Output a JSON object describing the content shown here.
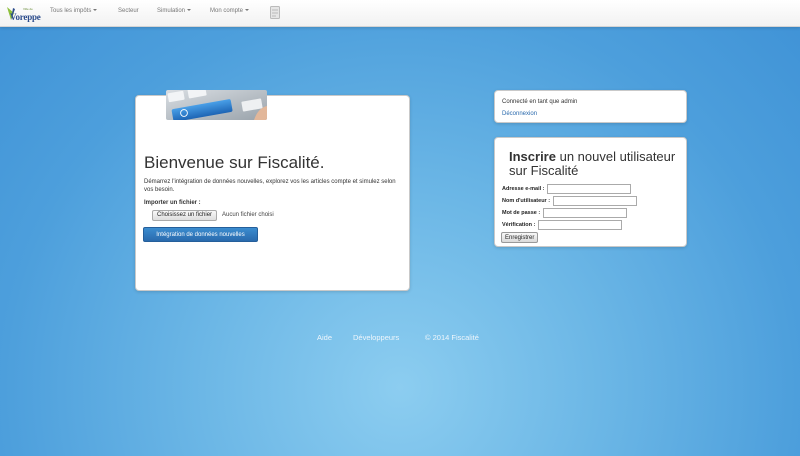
{
  "brand": {
    "name": "Voreppe",
    "tagline": "Ville de"
  },
  "nav": [
    {
      "label": "Tous les impôts",
      "dropdown": true
    },
    {
      "label": "Secteur",
      "dropdown": false
    },
    {
      "label": "Simulation",
      "dropdown": true
    },
    {
      "label": "Mon compte",
      "dropdown": true
    }
  ],
  "hero": {
    "image_key_label": "Fiscalité",
    "title": "Bienvenue sur Fiscalité.",
    "intro": "Démarrez l'intégration de données nouvelles, explorez vos les articles compte et simulez selon vos besoin.",
    "import_label": "Importer un fichier :",
    "file_button": "Choisissez un fichier",
    "file_status": "Aucun fichier choisi",
    "primary_button": "Intégration de données nouvelles"
  },
  "session": {
    "status": "Connecté en tant que admin",
    "logout": "Déconnexion"
  },
  "register": {
    "title_bold": "Inscrire",
    "title_rest": " un nouvel utilisateur sur Fiscalité",
    "fields": [
      {
        "label": "Adresse e-mail :",
        "value": ""
      },
      {
        "label": "Nom d'utilisateur :",
        "value": ""
      },
      {
        "label": "Mot de passe :",
        "value": ""
      },
      {
        "label": "Vérification :",
        "value": ""
      }
    ],
    "submit": "Enregistrer"
  },
  "footer": {
    "help": "Aide",
    "developers": "Développeurs",
    "copyright": "© 2014 Fiscalité"
  },
  "colors": {
    "accent": "#2a6aad",
    "background": "#4d9fdc"
  }
}
